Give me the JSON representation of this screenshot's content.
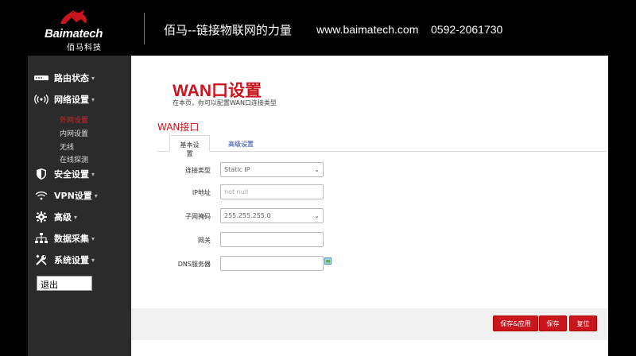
{
  "header": {
    "logo_en": "Baimatech",
    "logo_cn": "佰马科技",
    "slogan": "佰马--链接物联网的力量",
    "website": "www.baimatech.com",
    "phone": "0592-2061730"
  },
  "sidebar": {
    "items": [
      {
        "label": "路由状态",
        "icon": "router-icon"
      },
      {
        "label": "网络设置",
        "icon": "wireless-signal-icon"
      },
      {
        "label": "安全设置",
        "icon": "shield-icon"
      },
      {
        "label": "VPN设置",
        "icon": "wifi-icon"
      },
      {
        "label": "高级",
        "icon": "gear-icon"
      },
      {
        "label": "数据采集",
        "icon": "network-nodes-icon"
      },
      {
        "label": "系统设置",
        "icon": "tools-icon"
      }
    ],
    "subitems": [
      "外网设置",
      "内网设置",
      "无线",
      "在线探测"
    ],
    "logout": "退出"
  },
  "main": {
    "title": "WAN口设置",
    "description": "在本页，你可以配置WAN口连接类型",
    "section_title": "WAN接口",
    "tabs": [
      "基本设置",
      "高级设置"
    ],
    "fields": [
      {
        "label": "连接类型",
        "value": "Static IP",
        "type": "select"
      },
      {
        "label": "IP地址",
        "value": "",
        "placeholder": "not null",
        "type": "text"
      },
      {
        "label": "子网掩码",
        "value": "255.255.255.0",
        "type": "select"
      },
      {
        "label": "网关",
        "value": "",
        "type": "text"
      },
      {
        "label": "DNS服务器",
        "value": "",
        "type": "text"
      }
    ],
    "buttons": {
      "save_apply": "保存&应用",
      "save": "保存",
      "reset": "复位"
    }
  },
  "colors": {
    "accent": "#c9151e",
    "sidebar_bg": "#2b2b2b",
    "link_blue": "#1a3ea8"
  }
}
